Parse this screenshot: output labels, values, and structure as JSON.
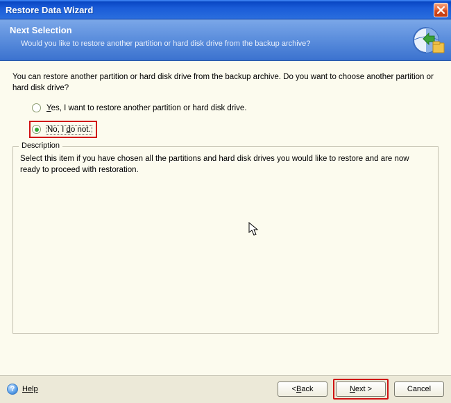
{
  "window": {
    "title": "Restore Data Wizard"
  },
  "header": {
    "title": "Next Selection",
    "subtitle": "Would you like to restore another partition or hard disk drive from the backup archive?"
  },
  "content": {
    "intro": "You can restore another partition or hard disk drive from the backup archive. Do you want to choose another partition or hard disk drive?",
    "option_yes_prefix": "Y",
    "option_yes_rest": "es, I want to restore another partition or hard disk drive.",
    "option_no_prefix": "No, I ",
    "option_no_mnemonic": "d",
    "option_no_rest": "o not.",
    "description_legend": "Description",
    "description_text": "Select this item if you have chosen all the partitions and hard disk drives you would like to restore and are now ready to proceed with restoration."
  },
  "footer": {
    "help_label": "Help",
    "back_pre": "< ",
    "back_mnemonic": "B",
    "back_rest": "ack",
    "next_mnemonic": "N",
    "next_rest": "ext >",
    "cancel_label": "Cancel"
  }
}
